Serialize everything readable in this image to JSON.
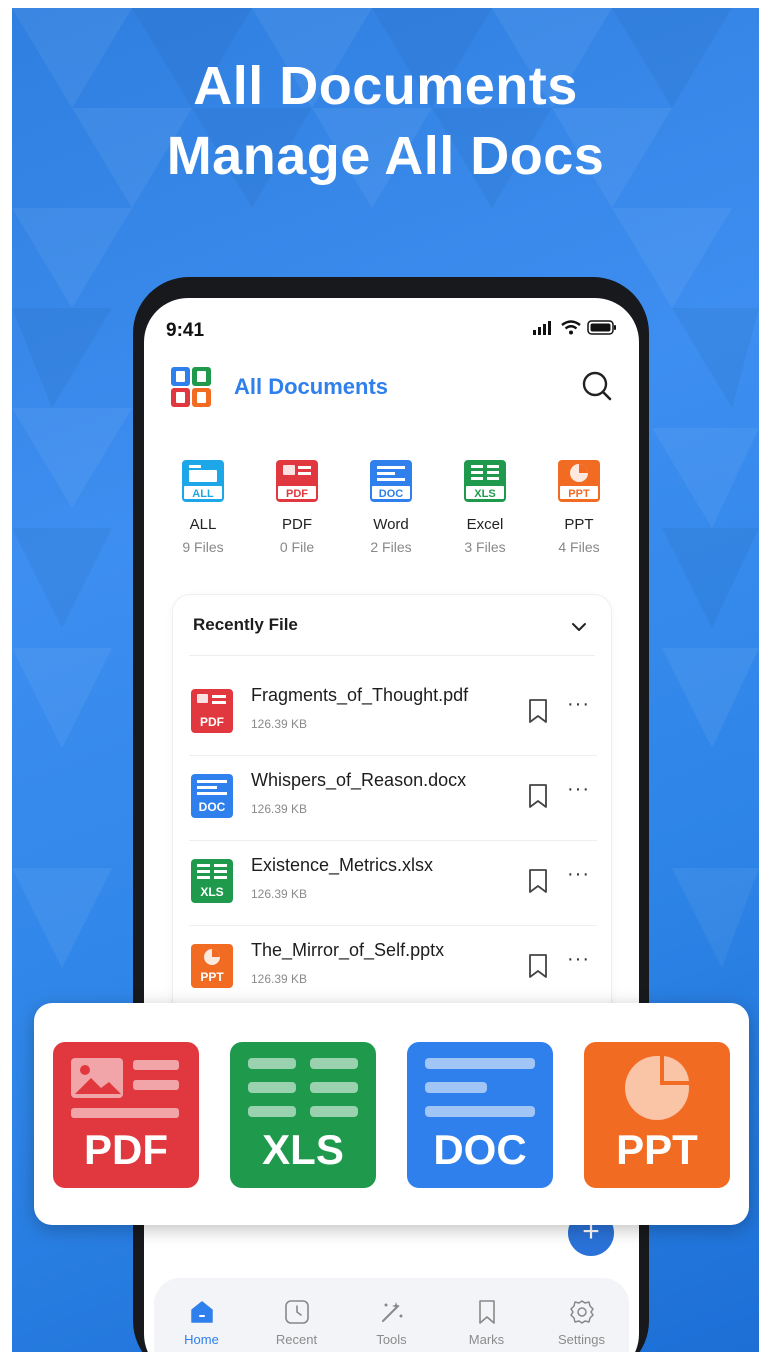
{
  "headline": {
    "line1": "All Documents",
    "line2": "Manage All Docs"
  },
  "status_bar": {
    "time": "9:41"
  },
  "app": {
    "title": "All Documents"
  },
  "categories": [
    {
      "label": "ALL",
      "count": "9 Files",
      "icon_text": "ALL",
      "color": "#1ea7e8"
    },
    {
      "label": "PDF",
      "count": "0 File",
      "icon_text": "PDF",
      "color": "#e0383e"
    },
    {
      "label": "Word",
      "count": "2 Files",
      "icon_text": "DOC",
      "color": "#2f80ec"
    },
    {
      "label": "Excel",
      "count": "3 Files",
      "icon_text": "XLS",
      "color": "#1f9a4d"
    },
    {
      "label": "PPT",
      "count": "4 Files",
      "icon_text": "PPT",
      "color": "#f26b23"
    }
  ],
  "recent": {
    "title": "Recently File",
    "files": [
      {
        "name": "Fragments_of_Thought.pdf",
        "size": "126.39 KB",
        "icon_text": "PDF",
        "color": "#e0383e"
      },
      {
        "name": "Whispers_of_Reason.docx",
        "size": "126.39 KB",
        "icon_text": "DOC",
        "color": "#2f80ec"
      },
      {
        "name": "Existence_Metrics.xlsx",
        "size": "126.39 KB",
        "icon_text": "XLS",
        "color": "#1f9a4d"
      },
      {
        "name": "The_Mirror_of_Self.pptx",
        "size": "126.39 KB",
        "icon_text": "PPT",
        "color": "#f26b23"
      }
    ],
    "more_glyph": "···"
  },
  "fab": {
    "glyph": "+"
  },
  "nav": [
    {
      "label": "Home",
      "icon": "home-icon",
      "active": true
    },
    {
      "label": "Recent",
      "icon": "clock-icon",
      "active": false
    },
    {
      "label": "Tools",
      "icon": "tools-icon",
      "active": false
    },
    {
      "label": "Marks",
      "icon": "bookmark-icon",
      "active": false
    },
    {
      "label": "Settings",
      "icon": "gear-icon",
      "active": false
    }
  ],
  "big_tiles": [
    {
      "label": "PDF",
      "color": "#e0383e"
    },
    {
      "label": "XLS",
      "color": "#1f9a4d"
    },
    {
      "label": "DOC",
      "color": "#2f80ec"
    },
    {
      "label": "PPT",
      "color": "#f26b23"
    }
  ],
  "colors": {
    "accent": "#2f80ec",
    "banner": "#3d8ef0"
  }
}
